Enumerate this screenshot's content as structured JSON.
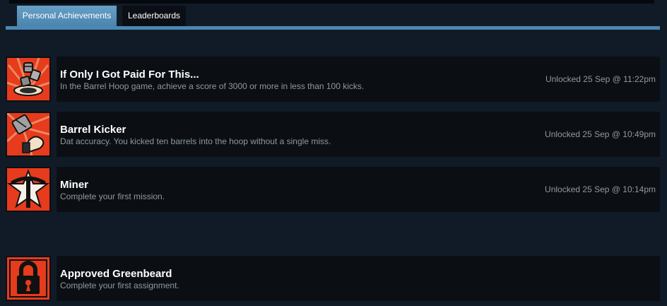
{
  "tabs": {
    "personal": "Personal Achievements",
    "leaderboards": "Leaderboards"
  },
  "achievements": [
    {
      "title": "If Only I Got Paid For This...",
      "description": "In the Barrel Hoop game, achieve a score of 3000 or more in less than 100 kicks.",
      "unlocked": "Unlocked 25 Sep @ 11:22pm",
      "icon": "barrels-hoop-icon"
    },
    {
      "title": "Barrel Kicker",
      "description": "Dat accuracy. You kicked ten barrels into the hoop without a single miss.",
      "unlocked": "Unlocked 25 Sep @ 10:49pm",
      "icon": "barrel-kick-icon"
    },
    {
      "title": "Miner",
      "description": "Complete your first mission.",
      "unlocked": "Unlocked 25 Sep @ 10:14pm",
      "icon": "pickaxe-star-icon"
    },
    {
      "title": "Approved Greenbeard",
      "description": "Complete your first assignment.",
      "unlocked": "",
      "icon": "padlock-icon"
    }
  ],
  "colors": {
    "background": "#111b27",
    "row": "#0b0f14",
    "accent": "#4b88b3",
    "icon_red": "#e63b1c"
  }
}
